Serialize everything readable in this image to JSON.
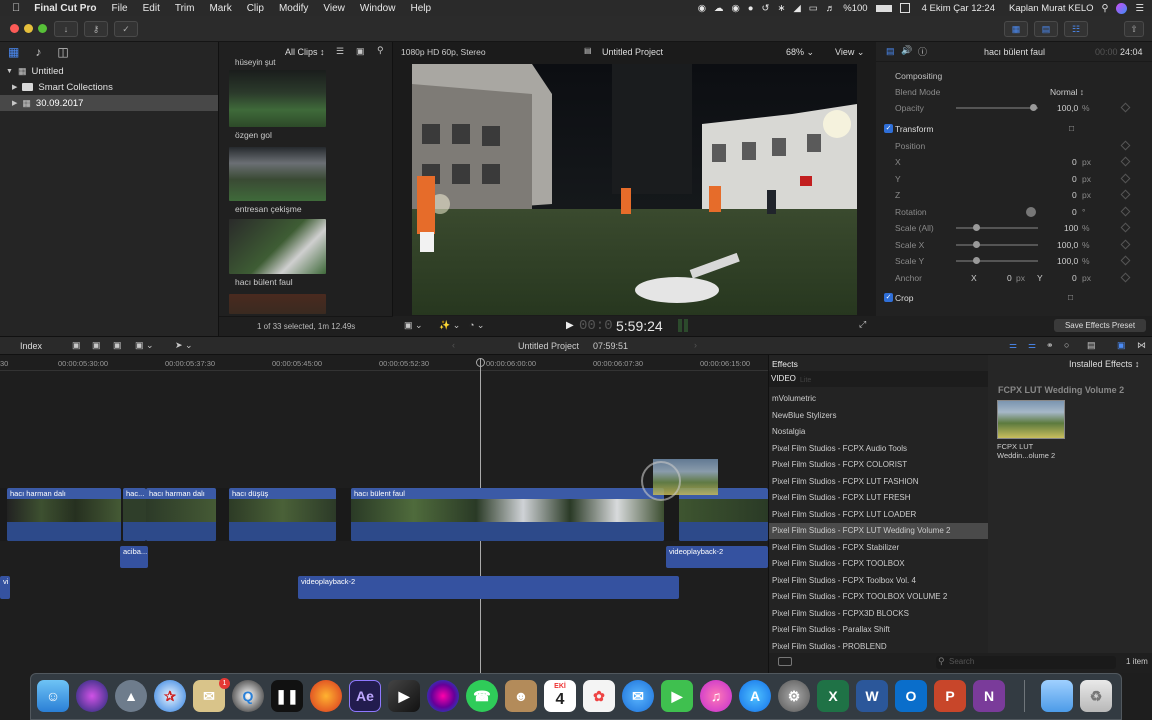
{
  "menubar": {
    "app_name": "Final Cut Pro",
    "items": [
      "File",
      "Edit",
      "Trim",
      "Mark",
      "Clip",
      "Modify",
      "View",
      "Window",
      "Help"
    ],
    "battery": "%100",
    "datetime": "4 Ekim Çar 12:24",
    "user": "Kaplan Murat KELO"
  },
  "library": {
    "root": "Untitled",
    "items": [
      "Smart Collections",
      "30.09.2017"
    ],
    "filter_label": "All Clips"
  },
  "clips": {
    "partial_top_label": "hüseyin şut",
    "items": [
      "özgen gol",
      "entresan çekişme",
      "hacı bülent faul"
    ],
    "status": "1 of 33 selected, 1m 12.49s"
  },
  "viewer": {
    "format": "1080p HD 60p, Stereo",
    "project": "Untitled Project",
    "zoom": "68%",
    "view_label": "View",
    "timecode_dim": "00:0",
    "timecode": "5:59:24"
  },
  "inspector": {
    "clip_name": "hacı bülent faul",
    "duration_dim": "00:00",
    "duration": "24:04",
    "compositing": "Compositing",
    "blend_mode_label": "Blend Mode",
    "blend_mode_value": "Normal",
    "opacity_label": "Opacity",
    "opacity_value": "100,0",
    "transform": "Transform",
    "position_label": "Position",
    "x_label": "X",
    "x_value": "0",
    "y_label": "Y",
    "y_value": "0",
    "z_label": "Z",
    "z_value": "0",
    "rotation_label": "Rotation",
    "rotation_value": "0",
    "rotation_unit": "°",
    "scale_all_label": "Scale (All)",
    "scale_all_value": "100",
    "scale_x_label": "Scale X",
    "scale_x_value": "100,0",
    "scale_y_label": "Scale Y",
    "scale_y_value": "100,0",
    "anchor_label": "Anchor",
    "anchor_x_label": "X",
    "anchor_x_value": "0",
    "anchor_y_label": "Y",
    "anchor_y_value": "0",
    "crop": "Crop",
    "unit_px": "px",
    "unit_pct": "%",
    "save_preset": "Save Effects Preset"
  },
  "timeline": {
    "index_label": "Index",
    "project": "Untitled Project",
    "duration": "07:59:51",
    "ruler": [
      "00:00:05:30:00",
      "00:00:05:37:30",
      "00:00:05:45:00",
      "00:00:05:52:30",
      "00:00:06:00:00",
      "00:00:06:07:30",
      "00:00:06:15:00"
    ],
    "ruler_first": "30",
    "clips": [
      "hacı harman dalı",
      "hac...",
      "hacı harman dalı",
      "hacı düşüş",
      "hacı bülent faul"
    ],
    "conn_clips": [
      "aciba...",
      "videoplayback-2",
      "videoplayback-2",
      "vi"
    ]
  },
  "effects": {
    "header": "Effects",
    "category": "VIDEO",
    "faded": "Lite",
    "items": [
      "mVolumetric",
      "NewBlue Stylizers",
      "Nostalgia",
      "Pixel Film Studios - FCPX Audio Tools",
      "Pixel Film Studios - FCPX COLORIST",
      "Pixel Film Studios - FCPX LUT FASHION",
      "Pixel Film Studios - FCPX LUT FRESH",
      "Pixel Film Studios - FCPX LUT LOADER",
      "Pixel Film Studios - FCPX LUT Wedding Volume 2",
      "Pixel Film Studios - FCPX Stabilizer",
      "Pixel Film Studios - FCPX TOOLBOX",
      "Pixel Film Studios - FCPX Toolbox Vol. 4",
      "Pixel Film Studios - FCPX TOOLBOX VOLUME 2",
      "Pixel Film Studios - FCPX3D BLOCKS",
      "Pixel Film Studios - Parallax Shift",
      "Pixel Film Studios - PROBLEND"
    ],
    "selected_index": 8,
    "installed_label": "Installed Effects",
    "preview_title": "FCPX LUT Wedding Volume 2",
    "preview_caption": "FCPX LUT Weddin...olume 2",
    "search_placeholder": "Search",
    "count": "1 item"
  },
  "dock": {
    "calendar_month": "EKİ",
    "calendar_day": "4",
    "badge": "1"
  },
  "colors": {
    "accent": "#2f6fd8",
    "clip_blue": "#3b5aa6",
    "audio_wave": "#6b84c2",
    "selected_row": "#4a4a4a"
  }
}
